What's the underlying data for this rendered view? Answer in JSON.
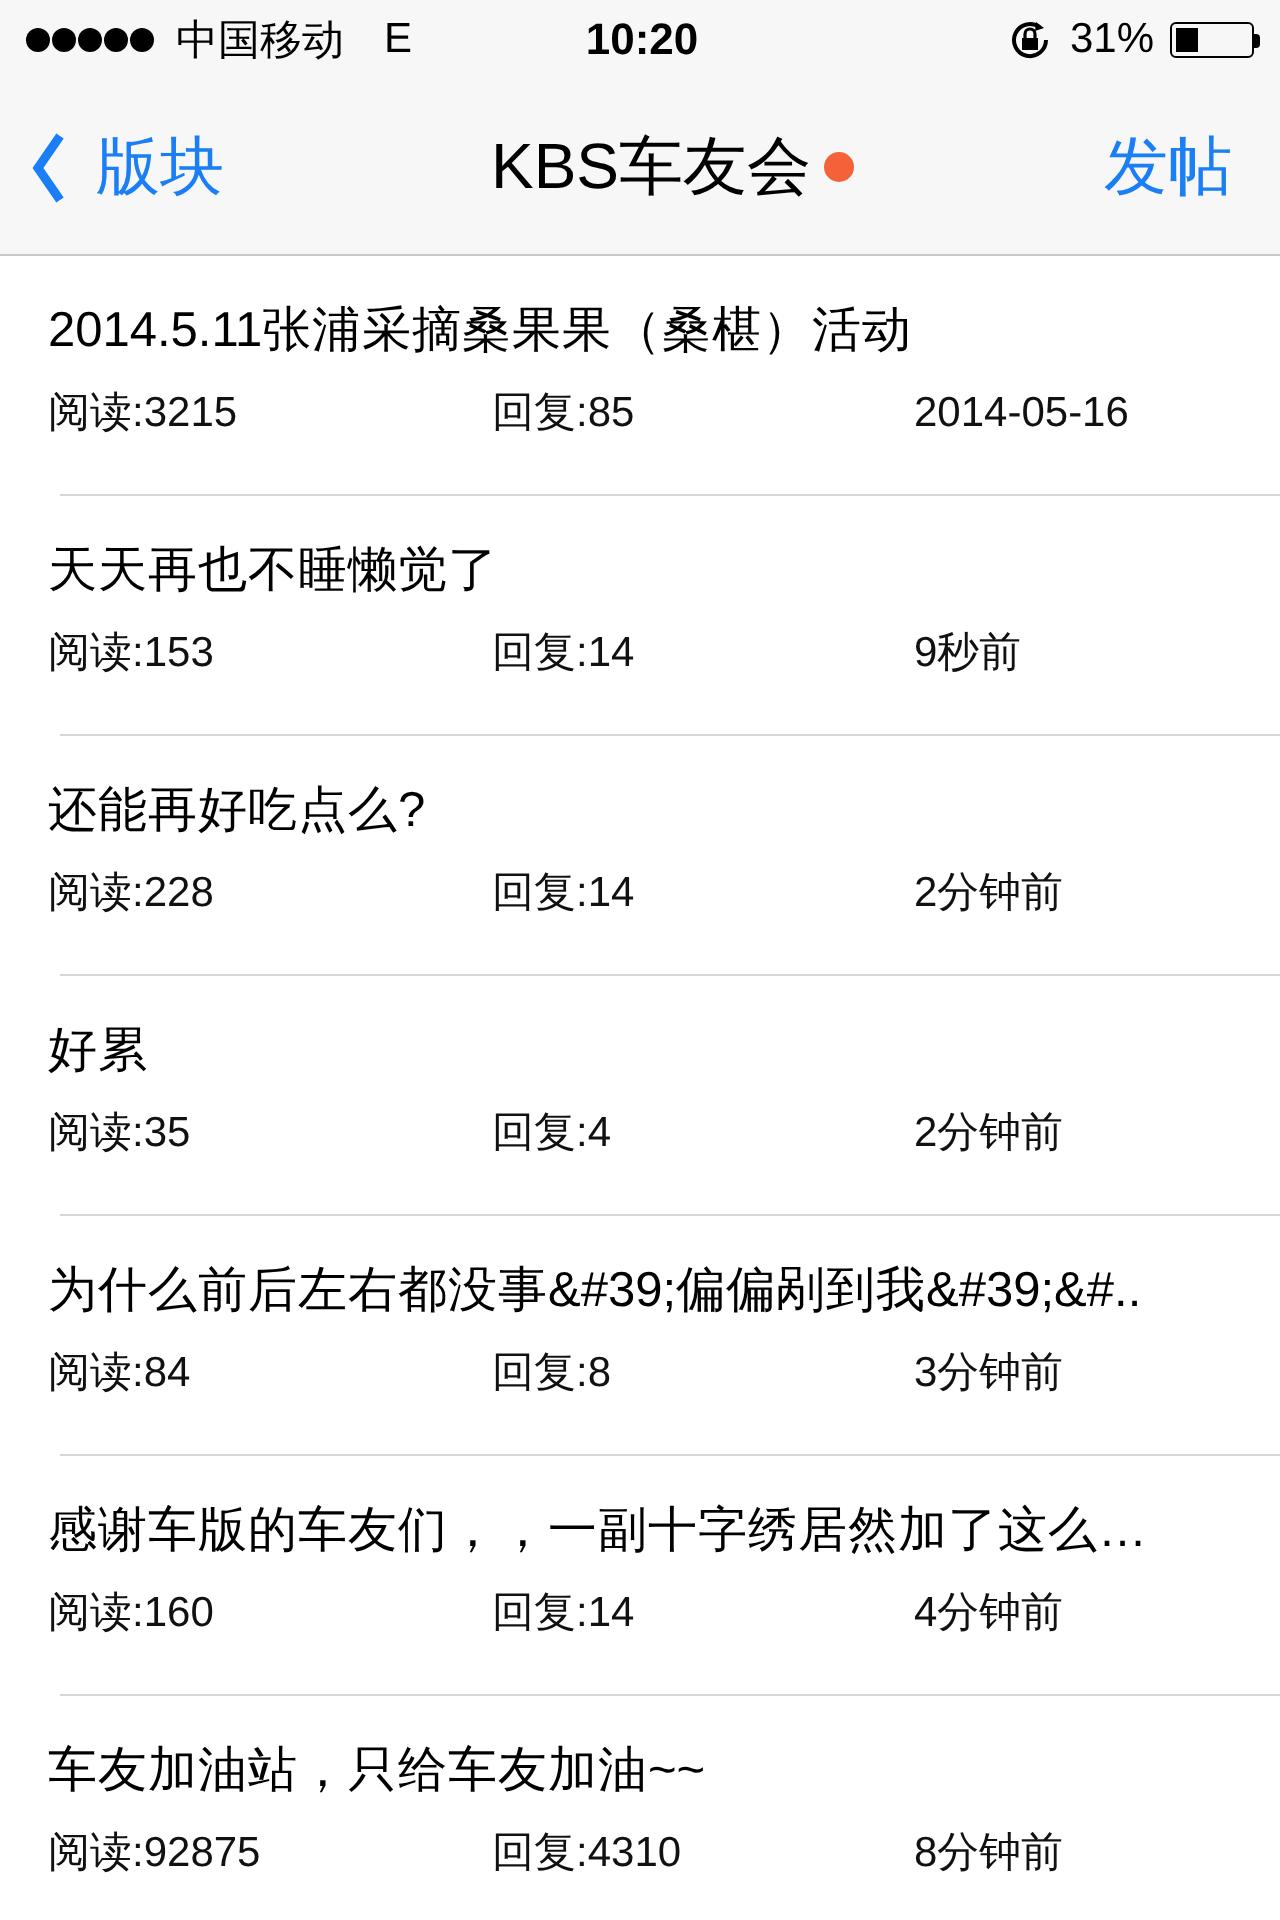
{
  "status_bar": {
    "carrier": "中国移动",
    "network": "E",
    "time": "10:20",
    "battery_text": "31%"
  },
  "nav_bar": {
    "back_label": "版块",
    "title": "KBS车友会",
    "title_dot": true,
    "action_label": "发帖"
  },
  "posts": [
    {
      "title": "2014.5.11张浦采摘桑果果（桑椹）活动",
      "reads": "阅读:3215",
      "replies": "回复:85",
      "time": "2014-05-16"
    },
    {
      "title": "天天再也不睡懒觉了",
      "reads": "阅读:153",
      "replies": "回复:14",
      "time": "9秒前"
    },
    {
      "title": "还能再好吃点么?",
      "reads": "阅读:228",
      "replies": "回复:14",
      "time": "2分钟前"
    },
    {
      "title": "好累",
      "reads": "阅读:35",
      "replies": "回复:4",
      "time": "2分钟前"
    },
    {
      "title": "为什么前后左右都没事&#39;偏偏剐到我&#39;&#..",
      "reads": "阅读:84",
      "replies": "回复:8",
      "time": "3分钟前"
    },
    {
      "title": "感谢车版的车友们，，一副十字绣居然加了这么…",
      "reads": "阅读:160",
      "replies": "回复:14",
      "time": "4分钟前"
    },
    {
      "title": "车友加油站，只给车友加油~~",
      "reads": "阅读:92875",
      "replies": "回复:4310",
      "time": "8分钟前"
    }
  ]
}
